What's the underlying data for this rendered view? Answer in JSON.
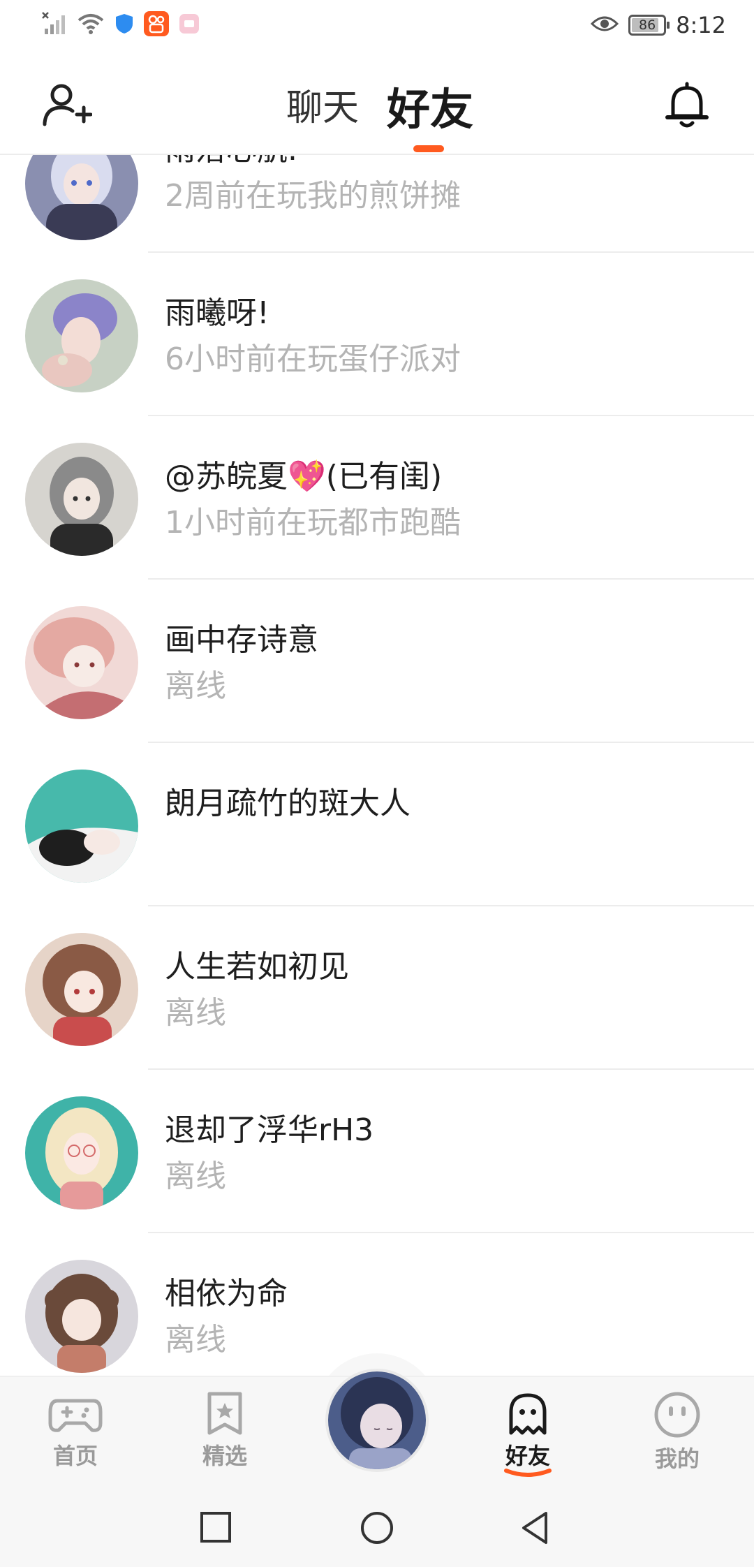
{
  "status_bar": {
    "time": "8:12",
    "battery": "86",
    "battery_level": 0.86,
    "icons": [
      "no-signal-icon",
      "wifi-icon",
      "shield-icon",
      "kuaishou-app-icon",
      "app-notification-icon",
      "eye-icon"
    ]
  },
  "header": {
    "tab_chat": "聊天",
    "tab_friends": "好友",
    "active_tab": "好友",
    "accent_color": "#ff5a1f"
  },
  "friends": [
    {
      "name": "雨落心航.",
      "status": "2周前在玩我的煎饼摊",
      "avatar_colors": [
        "#8a8fb0",
        "#d9dcef",
        "#3a3b55"
      ]
    },
    {
      "name": "雨曦呀!",
      "status": "6小时前在玩蛋仔派对",
      "avatar_colors": [
        "#c7d1c4",
        "#8b84c9",
        "#e9c7c0"
      ]
    },
    {
      "name": "@苏皖夏💖(已有闺)",
      "status": "1小时前在玩都市跑酷",
      "avatar_colors": [
        "#d6d4cf",
        "#8a8a8a",
        "#2a2a2a"
      ]
    },
    {
      "name": "画中存诗意",
      "status": "离线",
      "avatar_colors": [
        "#f1d9d6",
        "#e4a9a2",
        "#c46e72"
      ]
    },
    {
      "name": "朗月疏竹的斑大人",
      "status": "",
      "avatar_colors": [
        "#47b9ab",
        "#f2f2f2",
        "#1e1e1e"
      ]
    },
    {
      "name": "人生若如初见",
      "status": "离线",
      "avatar_colors": [
        "#e6d4c8",
        "#8a5a45",
        "#c94d4d"
      ]
    },
    {
      "name": "退却了浮华rH3",
      "status": "离线",
      "avatar_colors": [
        "#3fb3a8",
        "#f3e6c3",
        "#e69a9a"
      ]
    },
    {
      "name": "相依为命",
      "status": "离线",
      "avatar_colors": [
        "#d8d6dc",
        "#6a4a3a",
        "#c47d6a"
      ]
    }
  ],
  "bottom_nav": {
    "home": "首页",
    "featured": "精选",
    "friends": "好友",
    "mine": "我的",
    "active": "好友"
  },
  "system_nav": {
    "icons": [
      "recent-apps-icon",
      "home-icon",
      "back-icon"
    ]
  }
}
